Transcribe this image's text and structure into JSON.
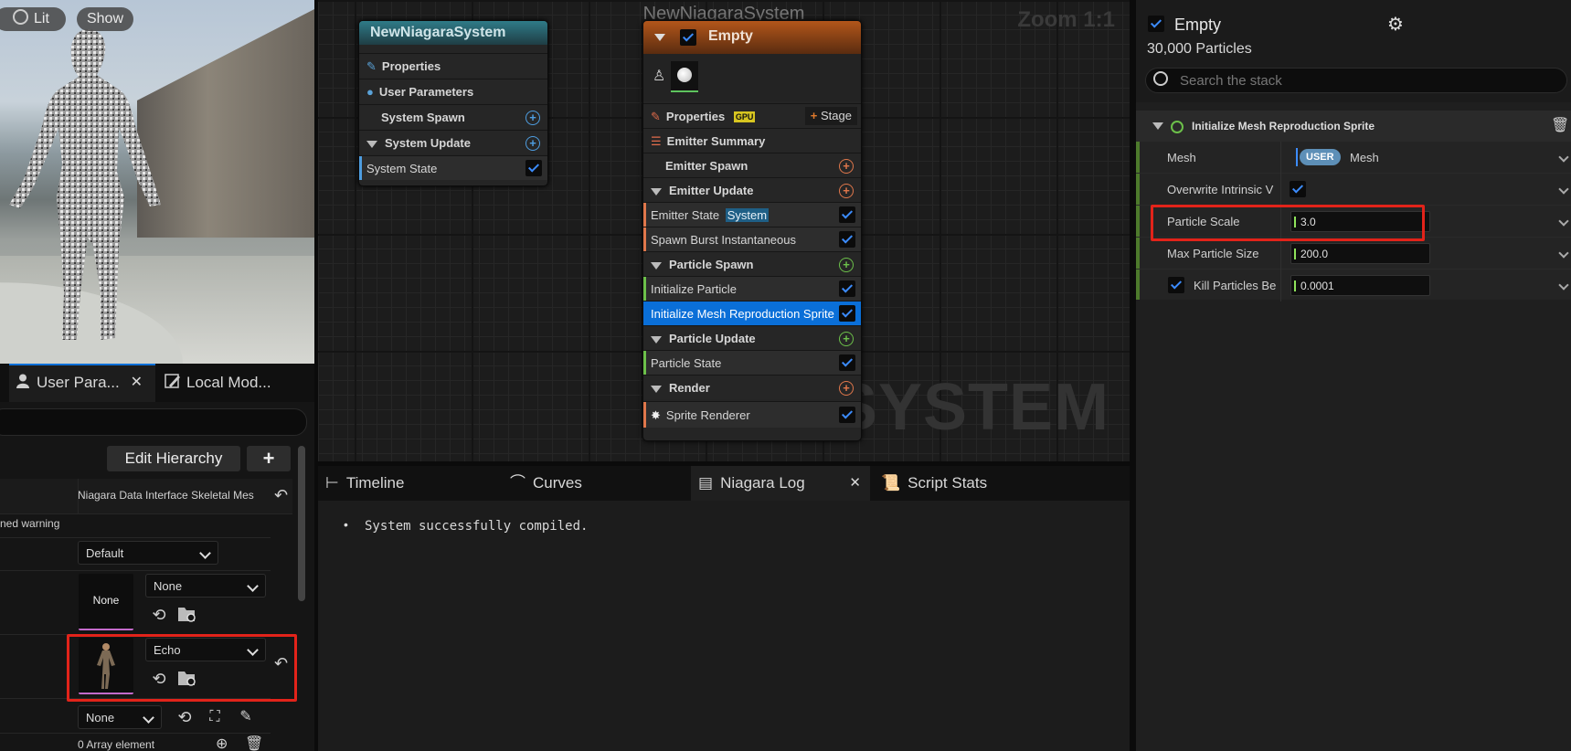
{
  "viewport": {
    "lit_label": "Lit",
    "show_label": "Show"
  },
  "left_panel": {
    "tabs": [
      {
        "label": "User Para...",
        "icon": "user-icon"
      },
      {
        "label": "Local Mod...",
        "icon": "graph-edit-icon"
      }
    ],
    "edit_hierarchy_label": "Edit Hierarchy",
    "add_label": "+",
    "rows": {
      "interface_name": "Niagara Data Interface Skeletal Mes",
      "warning_text": "ned warning",
      "default_option": "Default",
      "none_thumb_label": "None",
      "mesh_none_option": "None",
      "echo_option": "Echo",
      "bottom_none_option": "None",
      "array_text": "0 Array element"
    }
  },
  "graph": {
    "title": "NewNiagaraSystem",
    "zoom": "Zoom 1:1",
    "watermark": "SYSTEM",
    "system_node": {
      "title": "NewNiagaraSystem",
      "rows": [
        "Properties",
        "User Parameters",
        "System Spawn",
        "System Update",
        "System State"
      ]
    },
    "emitter_node": {
      "title": "Empty",
      "properties_label": "Properties",
      "gpu_badge": "GPU",
      "stage_label": "Stage",
      "summary_label": "Emitter Summary",
      "emitter_spawn": "Emitter Spawn",
      "emitter_update": "Emitter Update",
      "emitter_state": "Emitter State",
      "system_badge": "System",
      "spawn_burst": "Spawn Burst Instantaneous",
      "particle_spawn": "Particle Spawn",
      "initialize_particle": "Initialize Particle",
      "init_mesh_repro": "Initialize Mesh Reproduction Sprite",
      "particle_update": "Particle Update",
      "particle_state": "Particle State",
      "render": "Render",
      "sprite_renderer": "Sprite Renderer"
    }
  },
  "log_panel": {
    "tabs": [
      "Timeline",
      "Curves",
      "Niagara Log",
      "Script Stats"
    ],
    "messages": [
      "System successfully compiled."
    ]
  },
  "stack": {
    "emitter_name": "Empty",
    "particle_count": "30,000 Particles",
    "search_placeholder": "Search the stack",
    "module_title": "Initialize Mesh Reproduction Sprite",
    "params": {
      "mesh_label": "Mesh",
      "mesh_badge": "USER",
      "mesh_value": "Mesh",
      "overwrite_label": "Overwrite Intrinsic V",
      "scale_label": "Particle Scale",
      "scale_value": "3.0",
      "max_size_label": "Max Particle Size",
      "max_size_value": "200.0",
      "kill_label": "Kill Particles Be",
      "kill_value": "0.0001"
    }
  },
  "colors": {
    "highlight_red": "#e2231a",
    "selection_blue": "#0a6fd8",
    "emitter_header_orange": "#9a4a12",
    "system_header_teal": "#2c6e7a",
    "value_green": "#8fe35b"
  }
}
